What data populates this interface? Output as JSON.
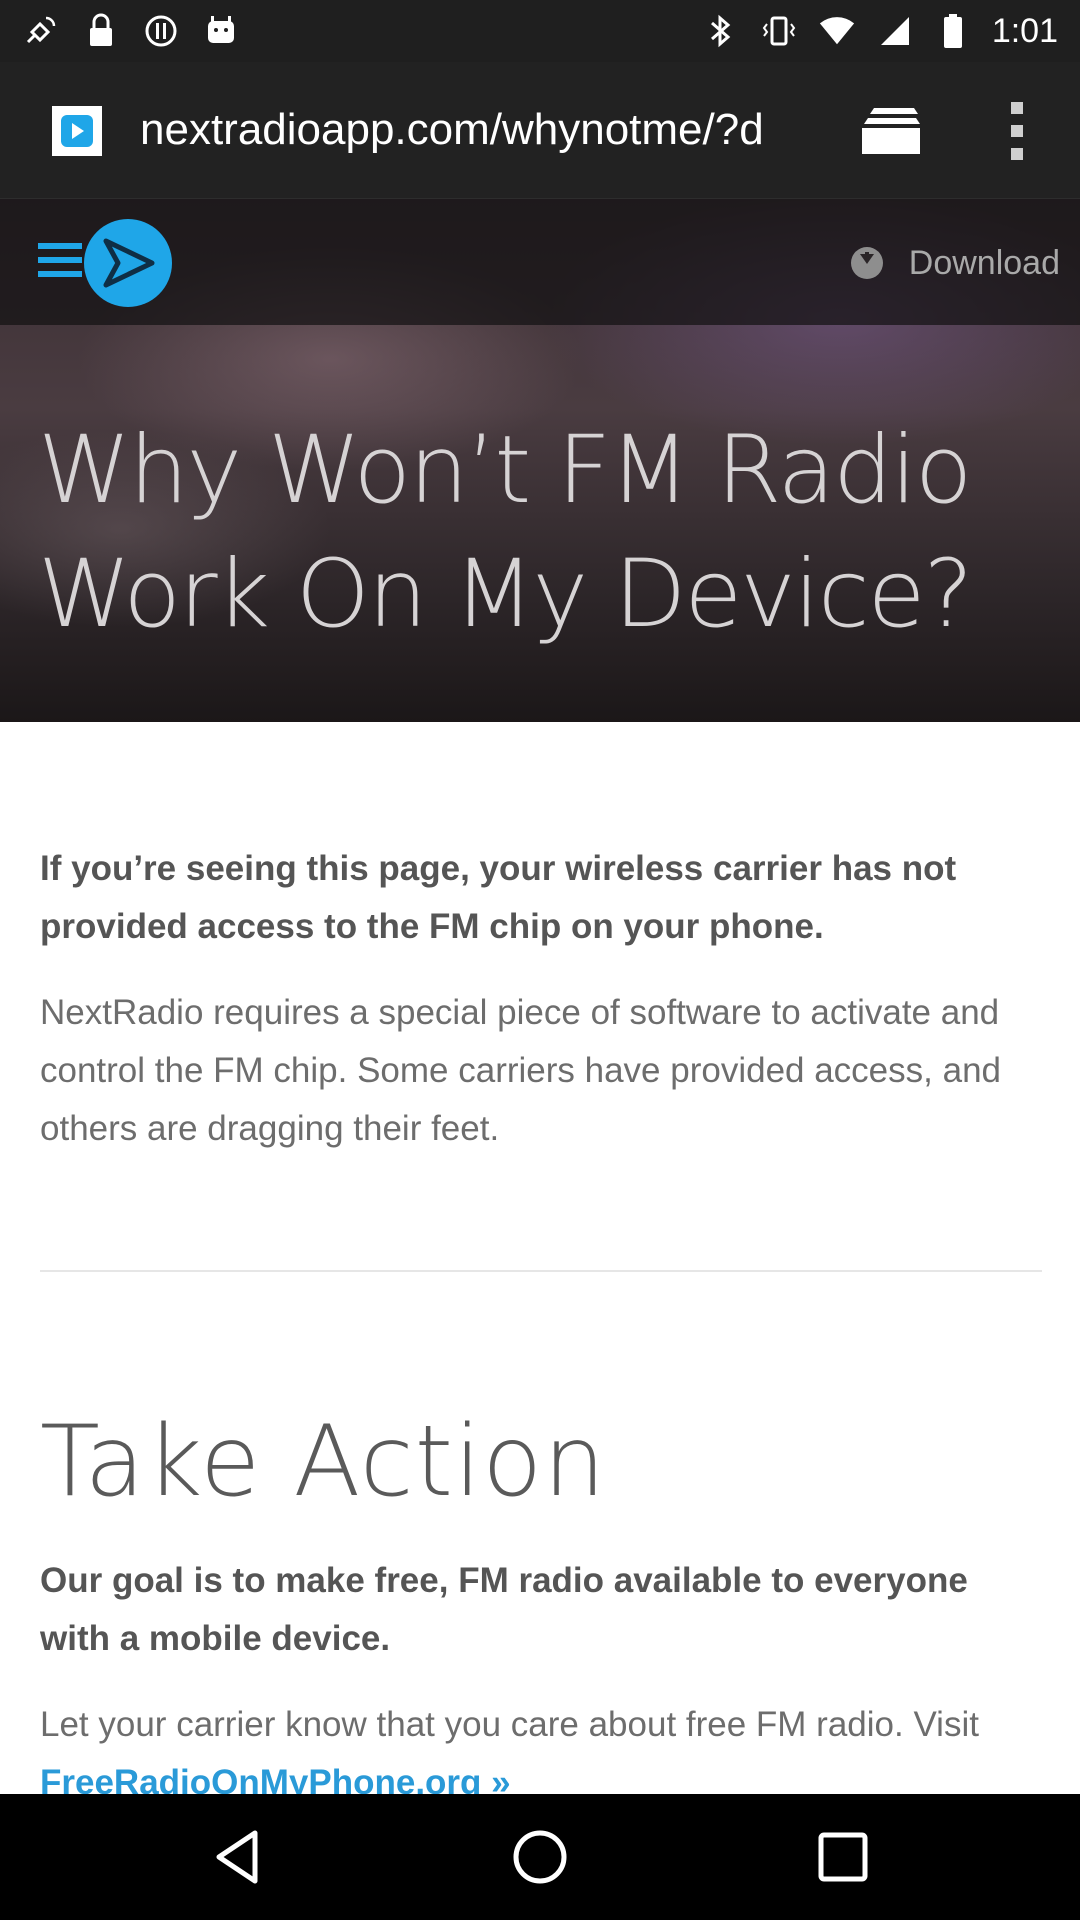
{
  "status_bar": {
    "time": "1:01",
    "left_icons": [
      "fake-gps-icon",
      "lock-icon",
      "circle-info-icon",
      "android-icon"
    ],
    "right_icons": [
      "bluetooth-icon",
      "vibrate-icon",
      "wifi-icon",
      "signal-icon",
      "battery-icon"
    ]
  },
  "browser": {
    "url": "nextradioapp.com/whynotme/?d",
    "favicon": "nextradio-play-icon",
    "tabs_icon": "tabs-stack-icon",
    "menu_icon": "overflow-menu-icon"
  },
  "header": {
    "download_label": "Download",
    "logo": "nextradio-logo"
  },
  "hero": {
    "title": "Why Won’t FM Radio Work On My Device?"
  },
  "content": {
    "lead": "If you’re seeing this page, your wireless carrier has not provided access to the FM chip on your phone.",
    "body": "NextRadio requires a special piece of software to activate and control the FM chip. Some carriers have provided access, and others are dragging their feet.",
    "section_title": "Take Action",
    "lead_2": "Our goal is to make free, FM radio available to everyone with a mobile device.",
    "body_2_prefix": "Let your carrier know that you care about free FM radio. Visit",
    "link_text": "FreeRadioOnMyPhone.org »"
  },
  "colors": {
    "link": "#2a9ad8",
    "logo_blue": "#1fa6e8",
    "status_bar": "#1f1f1f",
    "browser_bar": "#222222"
  },
  "nav": {
    "back_icon": "back-triangle-icon",
    "home_icon": "home-circle-icon",
    "recents_icon": "recents-square-icon"
  }
}
